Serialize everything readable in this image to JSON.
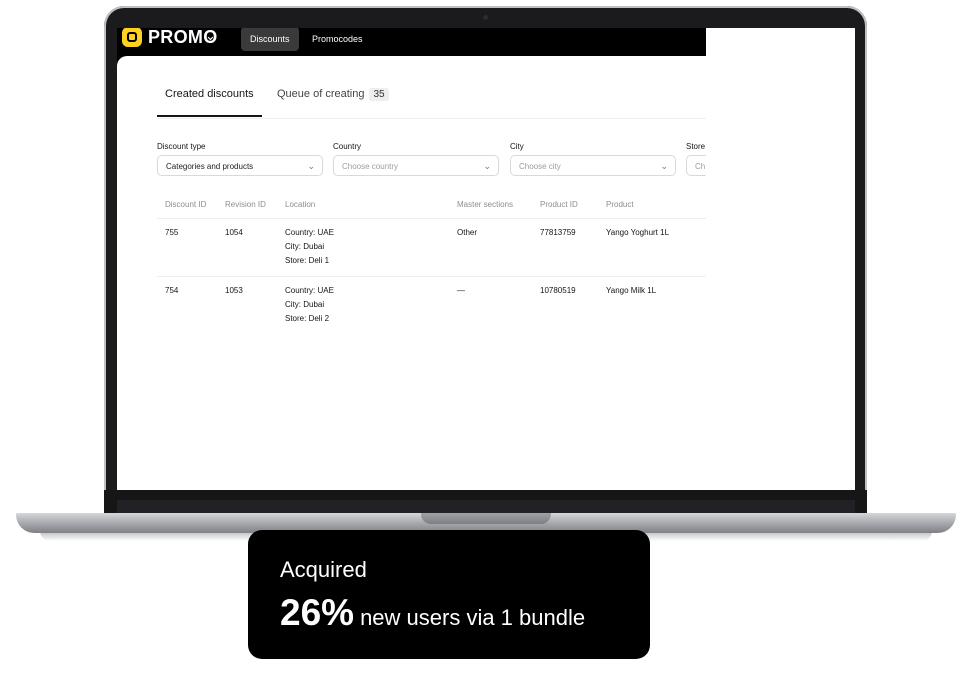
{
  "app": {
    "logo": "PROMO",
    "nav": [
      {
        "label": "Discounts",
        "active": true
      },
      {
        "label": "Promocodes",
        "active": false
      }
    ]
  },
  "tabs": {
    "created": "Created discounts",
    "queue": "Queue of creating",
    "queue_count": "35"
  },
  "filters": {
    "discount_type": {
      "label": "Discount type",
      "value": "Categories and products"
    },
    "country": {
      "label": "Country",
      "placeholder": "Choose country"
    },
    "city": {
      "label": "City",
      "placeholder": "Choose city"
    },
    "store": {
      "label": "Store",
      "placeholder": "Ch"
    }
  },
  "table": {
    "headers": [
      "Discount ID",
      "Revision ID",
      "Location",
      "Master sections",
      "Product ID",
      "Product"
    ],
    "rows": [
      {
        "discount_id": "755",
        "revision_id": "1054",
        "location": [
          "Country: UAE",
          "City: Dubai",
          "Store: Deli 1"
        ],
        "master_sections": "Other",
        "product_id": "77813759",
        "product": "Yango Yoghurt 1L"
      },
      {
        "discount_id": "754",
        "revision_id": "1053",
        "location": [
          "Country: UAE",
          "City: Dubai",
          "Store: Deli 2"
        ],
        "master_sections": "—",
        "product_id": "10780519",
        "product": "Yango Milk 1L"
      }
    ]
  },
  "badge": {
    "line1": "Acquired",
    "big": "26%",
    "rest": "new users via 1 bundle"
  }
}
